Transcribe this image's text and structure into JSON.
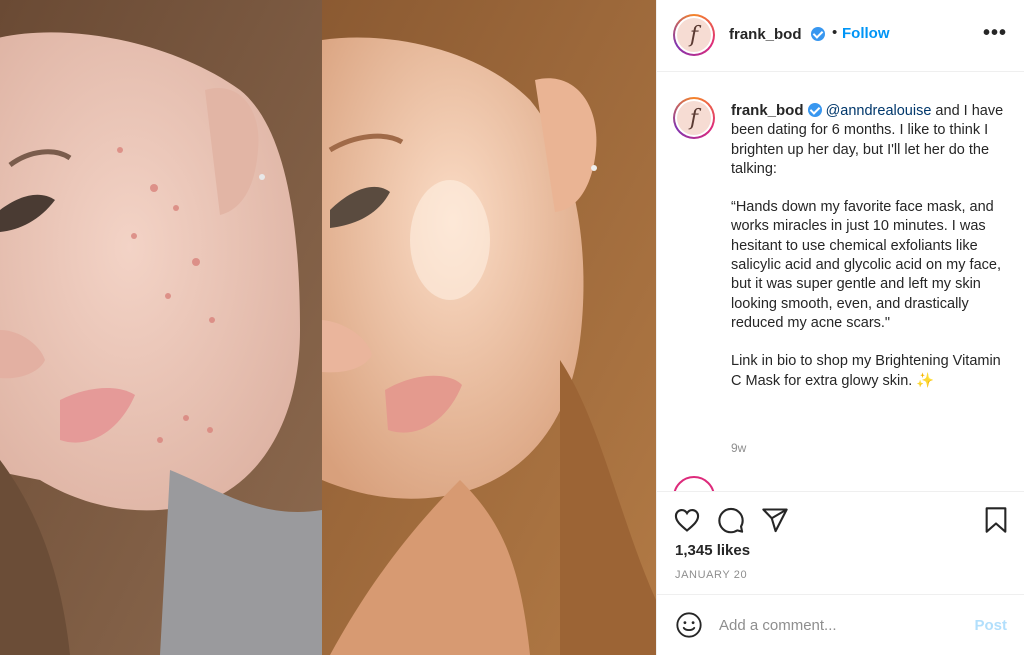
{
  "header": {
    "username": "frank_bod",
    "avatar_letter": "f",
    "dot": "•",
    "follow_label": "Follow",
    "more_label": "•••"
  },
  "caption": {
    "username": "frank_bod",
    "mention": "@anndrealouise",
    "line1": " and I have been dating for 6 months. I like to think I brighten up her day, but I'll let her do the talking:",
    "quote": "“Hands down my favorite face mask, and works miracles in just 10 minutes. I was hesitant to use chemical exfoliants like salicylic acid and glycolic acid on my face, but it was super gentle and left my skin looking smooth, even, and drastically reduced my acne scars.\"",
    "closing": "Link in bio to shop my Brightening Vitamin C Mask for extra glowy skin. ✨",
    "time": "9w"
  },
  "actions": {
    "likes": "1,345 likes",
    "date": "JANUARY 20"
  },
  "comment": {
    "placeholder": "Add a comment...",
    "post_label": "Post"
  },
  "colors": {
    "link": "#0095f6",
    "verified": "#3897f0",
    "muted": "#8e8e8e",
    "post_disabled": "#b2dffc"
  }
}
